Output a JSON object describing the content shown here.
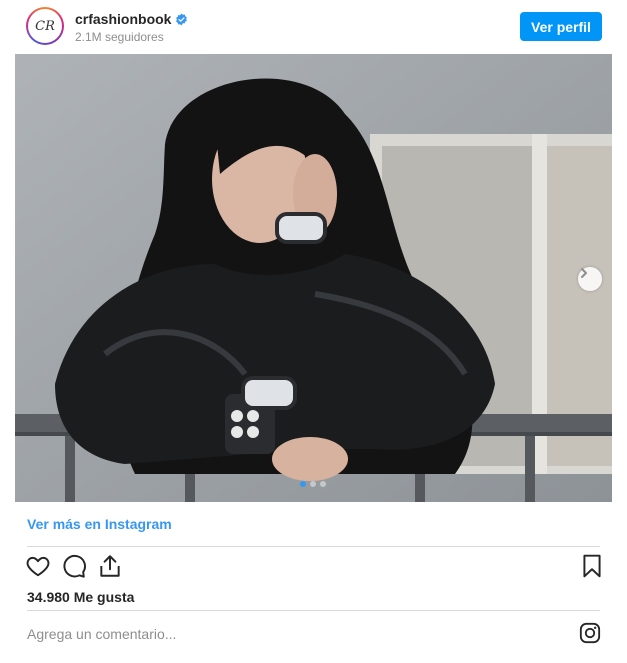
{
  "header": {
    "avatar_initials": "CR",
    "username": "crfashionbook",
    "verified": true,
    "followers": "2.1M seguidores",
    "view_profile_label": "Ver perfil"
  },
  "photo": {
    "carousel_total": 3,
    "carousel_current": 1
  },
  "more_link": "Ver más en Instagram",
  "actions": {
    "icons": [
      "heart-icon",
      "comment-icon",
      "share-icon",
      "bookmark-icon"
    ]
  },
  "likes_text": "34.980 Me gusta",
  "comment": {
    "placeholder": "Agrega un comentario..."
  },
  "colors": {
    "accent": "#0095f6",
    "link": "#3897f0",
    "text": "#262626",
    "muted": "#8e8e8e"
  }
}
